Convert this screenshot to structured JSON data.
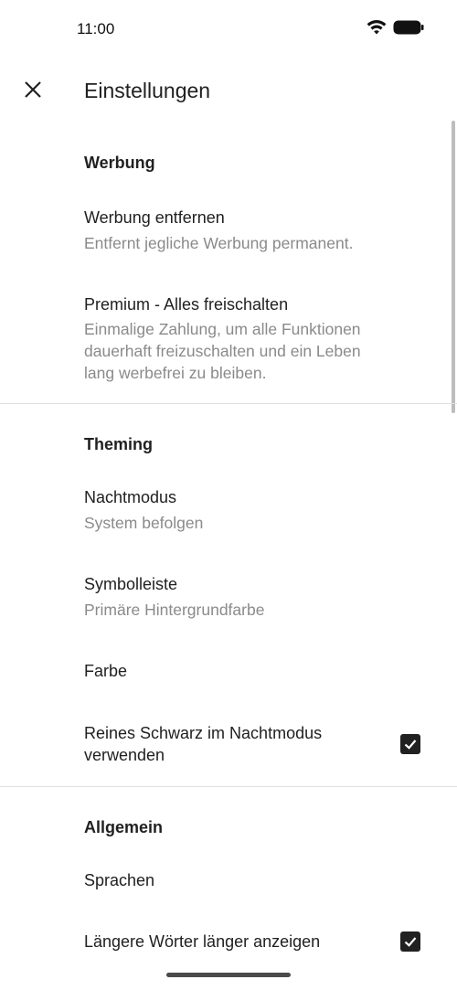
{
  "status_bar": {
    "time": "11:00",
    "icons": [
      "wifi-icon",
      "battery-icon"
    ]
  },
  "app_bar": {
    "close_icon": "close-icon",
    "title": "Einstellungen"
  },
  "sections": {
    "ads": {
      "title": "Werbung",
      "remove_ads": {
        "title": "Werbung entfernen",
        "summary": "Entfernt jegliche Werbung permanent."
      },
      "premium": {
        "title": "Premium - Alles freischalten",
        "summary_lines": [
          "Einmalige Zahlung, um alle Funktionen",
          "dauerhaft freizuschalten und ein Leben",
          "lang werbefrei zu bleiben."
        ]
      }
    },
    "theming": {
      "title": "Theming",
      "night_mode": {
        "title": "Nachtmodus",
        "summary": "System befolgen"
      },
      "toolbar": {
        "title": "Symbolleiste",
        "summary": "Primäre Hintergrundfarbe"
      },
      "color": {
        "title": "Farbe"
      },
      "pure_black": {
        "title_lines": [
          "Reines Schwarz im Nachtmodus",
          "verwenden"
        ],
        "checked": true
      }
    },
    "general": {
      "title": "Allgemein",
      "languages": {
        "title": "Sprachen"
      },
      "longer_words": {
        "title": "Längere Wörter länger anzeigen",
        "checked": true
      }
    }
  },
  "colors": {
    "checkbox": "#212121",
    "summary_text": "#8a8a8a",
    "divider": "#e0e0e0"
  }
}
